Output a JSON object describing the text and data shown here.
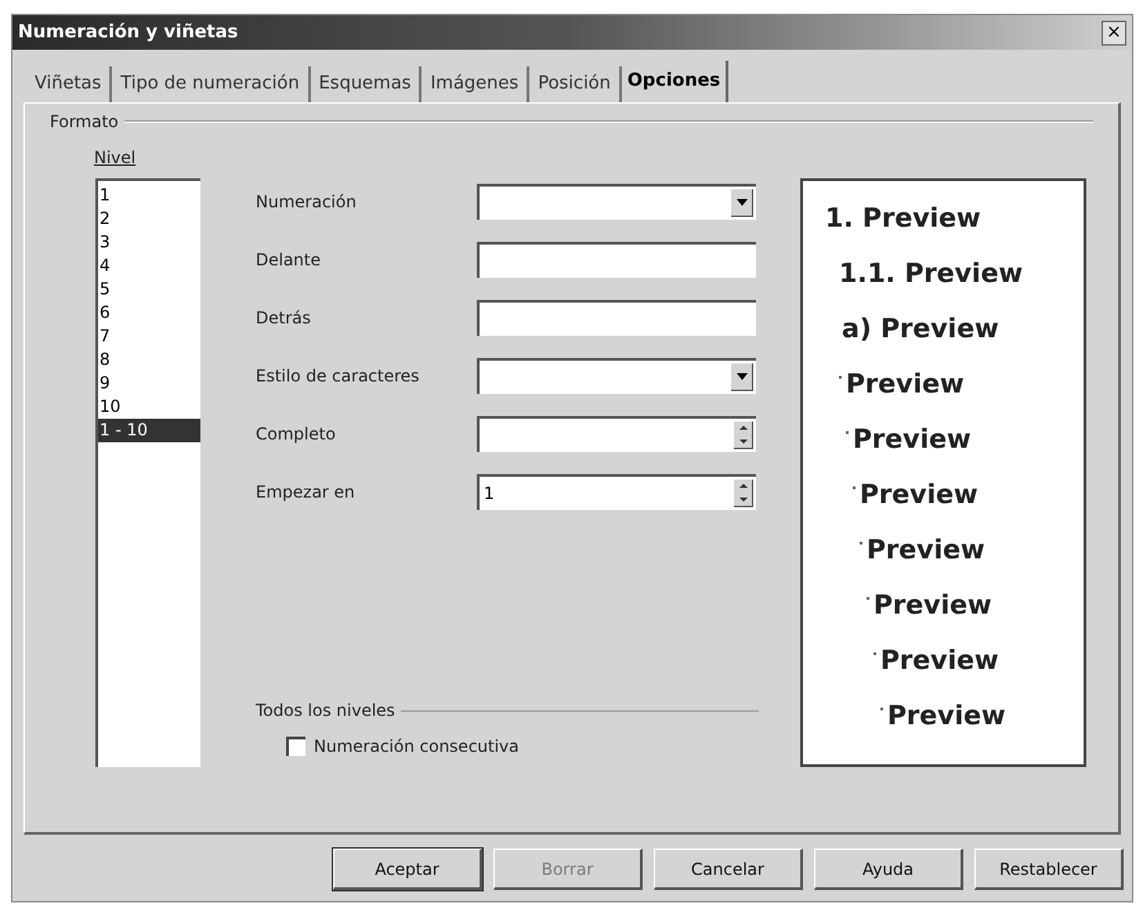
{
  "window": {
    "title": "Numeración y viñetas",
    "close": "×"
  },
  "tabs": [
    {
      "label": "Viñetas",
      "selected": false
    },
    {
      "label": "Tipo de numeración",
      "selected": false
    },
    {
      "label": "Esquemas",
      "selected": false
    },
    {
      "label": "Imágenes",
      "selected": false
    },
    {
      "label": "Posición",
      "selected": false
    },
    {
      "label": "Opciones",
      "selected": true
    }
  ],
  "format": {
    "title": "Formato",
    "level_label": "Nivel",
    "levels": [
      {
        "label": "1",
        "selected": false
      },
      {
        "label": "2",
        "selected": false
      },
      {
        "label": "3",
        "selected": false
      },
      {
        "label": "4",
        "selected": false
      },
      {
        "label": "5",
        "selected": false
      },
      {
        "label": "6",
        "selected": false
      },
      {
        "label": "7",
        "selected": false
      },
      {
        "label": "8",
        "selected": false
      },
      {
        "label": "9",
        "selected": false
      },
      {
        "label": "10",
        "selected": false
      },
      {
        "label": "1 - 10",
        "selected": true
      }
    ],
    "fields": [
      {
        "label": "Numeración",
        "kind": "dropdown"
      },
      {
        "label": "Delante",
        "kind": "text"
      },
      {
        "label": "Detrás",
        "kind": "text"
      },
      {
        "label": "Estilo de caracteres",
        "kind": "dropdown"
      },
      {
        "label": "Completo",
        "kind": "spin"
      },
      {
        "label": "Empezar en",
        "kind": "spin",
        "value": "1"
      }
    ],
    "all_levels": {
      "title": "Todos los niveles",
      "checkbox": {
        "label": "Numeración consecutiva",
        "checked": false
      }
    },
    "preview": [
      {
        "kind": "number",
        "prefix": "1.",
        "text": "Preview"
      },
      {
        "kind": "number",
        "prefix": "1.1.",
        "text": "Preview"
      },
      {
        "kind": "number",
        "prefix": "a)",
        "text": "Preview"
      },
      {
        "kind": "bullet",
        "text": "Preview"
      },
      {
        "kind": "bullet",
        "text": "Preview"
      },
      {
        "kind": "bullet",
        "text": "Preview"
      },
      {
        "kind": "bullet",
        "text": "Preview"
      },
      {
        "kind": "bullet",
        "text": "Preview"
      },
      {
        "kind": "bullet",
        "text": "Preview"
      },
      {
        "kind": "bullet",
        "text": "Preview"
      }
    ]
  },
  "buttons": [
    {
      "label": "Aceptar",
      "default": true,
      "disabled": false
    },
    {
      "label": "Borrar",
      "default": false,
      "disabled": true
    },
    {
      "label": "Cancelar",
      "default": false,
      "disabled": false
    },
    {
      "label": "Ayuda",
      "default": false,
      "disabled": false
    },
    {
      "label": "Restablecer",
      "default": false,
      "disabled": false
    }
  ]
}
